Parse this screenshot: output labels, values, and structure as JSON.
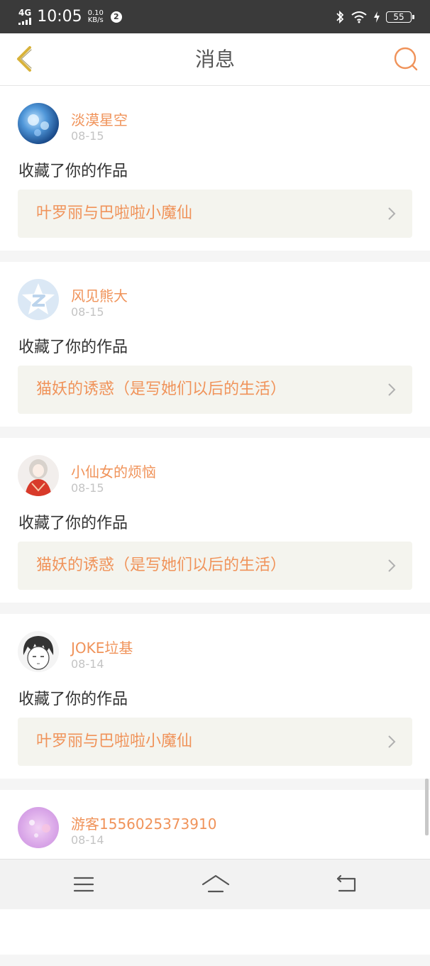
{
  "status_bar": {
    "network": "4G",
    "time": "10:05",
    "speed_value": "0.10",
    "speed_unit": "KB/s",
    "notification_count": "2",
    "battery": "55"
  },
  "header": {
    "title": "消息"
  },
  "messages": [
    {
      "username": "淡漠星空",
      "date": "08-15",
      "action": "收藏了你的作品",
      "work_title": "叶罗丽与巴啦啦小魔仙"
    },
    {
      "username": "风见熊大",
      "date": "08-15",
      "action": "收藏了你的作品",
      "work_title": "猫妖的诱惑（是写她们以后的生活）"
    },
    {
      "username": "小仙女的烦恼",
      "date": "08-15",
      "action": "收藏了你的作品",
      "work_title": "猫妖的诱惑（是写她们以后的生活）"
    },
    {
      "username": "JOKE垃基",
      "date": "08-14",
      "action": "收藏了你的作品",
      "work_title": "叶罗丽与巴啦啦小魔仙"
    },
    {
      "username": "游客1556025373910",
      "date": "08-14"
    }
  ],
  "colors": {
    "accent": "#f0935a",
    "back_arrow": "#d8b23a",
    "card_link_bg": "#f4f4ee"
  },
  "icons": {
    "back": "chevron-left-icon",
    "search": "search-icon",
    "row_arrow": "chevron-right-icon",
    "nav_menu": "menu-icon",
    "nav_home": "home-icon",
    "nav_back": "return-icon"
  }
}
